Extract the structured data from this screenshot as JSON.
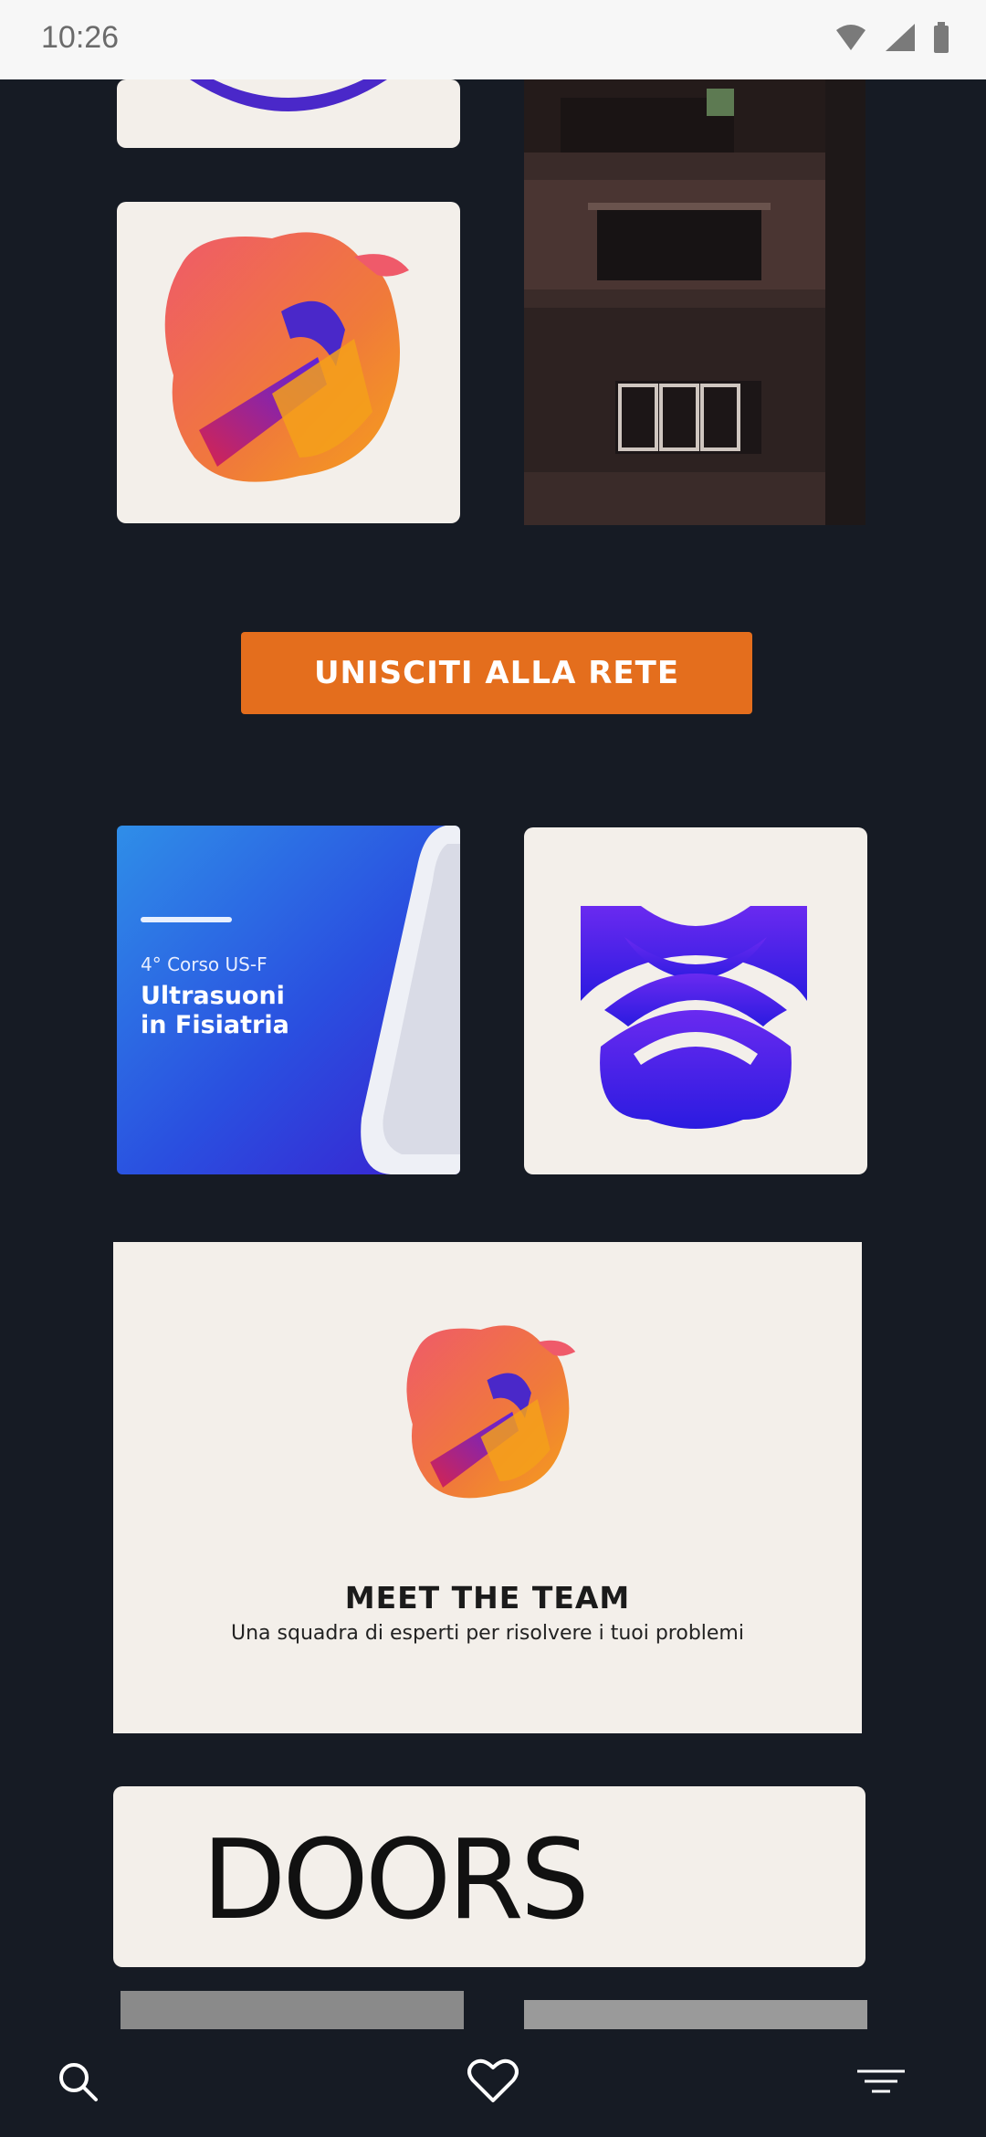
{
  "status_bar": {
    "time": "10:26"
  },
  "join_button": {
    "label": "UNISCITI ALLA RETE"
  },
  "course_card": {
    "subtitle": "4° Corso US-F",
    "title_line1": "Ultrasuoni",
    "title_line2": "in Fisiatria"
  },
  "team_card": {
    "title": "MEET THE TEAM",
    "subtitle": "Una squadra di esperti per risolvere i tuoi problemi"
  },
  "doors_card": {
    "logo_text": "DOORS"
  },
  "nav": {
    "items": [
      {
        "icon": "search-icon"
      },
      {
        "icon": "heart-icon"
      },
      {
        "icon": "menu-icon"
      }
    ]
  },
  "colors": {
    "background": "#161b24",
    "accent_orange": "#e46e1d",
    "purple": "#5a23e0",
    "card_bg": "#f3efea"
  }
}
